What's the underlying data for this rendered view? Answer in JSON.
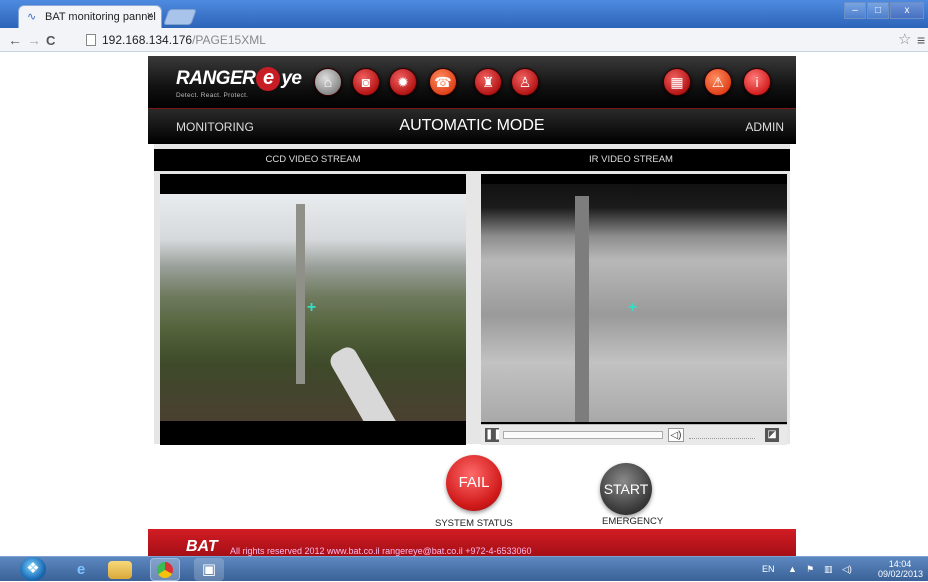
{
  "browser": {
    "tab_title": "BAT monitoring pannel",
    "tab_close": "×",
    "url_host": "192.168.134.176",
    "url_path": "/PAGE15XML",
    "back": "←",
    "forward": "→",
    "reload": "C",
    "star": "☆",
    "menu": "≡",
    "win_min": "–",
    "win_max": "□",
    "win_close": "x"
  },
  "header": {
    "logo_text_1": "RANGER",
    "logo_eye": "e",
    "logo_text_2": "ye",
    "logo_tagline": "Detect. React. Protect.",
    "nav_icons": [
      "home-icon",
      "camera-icon",
      "settings-gear-icon",
      "alarm-siren-icon",
      "event-icon",
      "joystick-icon"
    ],
    "right_icons": [
      "map-icon",
      "warning-icon",
      "info-icon"
    ]
  },
  "subheader": {
    "left": "MONITORING",
    "title": "AUTOMATIC MODE",
    "right": "ADMIN"
  },
  "streams": {
    "ccd_label": "CCD VIDEO STREAM",
    "ir_label": "IR VIDEO STREAM"
  },
  "controls": {
    "status_button": "FAIL",
    "status_label": "SYSTEM STATUS",
    "emergency_button": "START",
    "emergency_label": "EMERGENCY"
  },
  "footer": {
    "logo": "BAT",
    "text": "All rights reserved 2012    www.bat.co.il  rangereye@bat.co.il  +972-4-6533060"
  },
  "taskbar": {
    "lang": "EN",
    "time": "14:04",
    "date": "09/02/2013"
  },
  "colors": {
    "brand_red": "#c81d25",
    "crosshair": "#33e0c6"
  }
}
